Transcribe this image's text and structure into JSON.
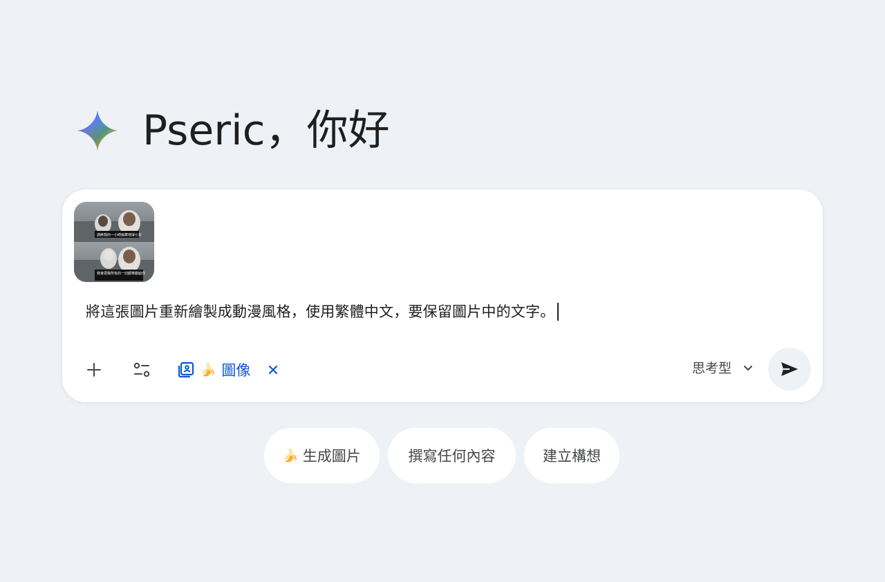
{
  "greeting": {
    "text": "Pseric，你好"
  },
  "composer": {
    "attachment": {
      "caption_top": "請將我的一小時換算地球七年",
      "caption_bottom": "我會把我所有的一切都奉獻給你"
    },
    "prompt": "將這張圖片重新繪製成動漫風格，使用繁體中文，要保留圖片中的文字。",
    "tool_chip": {
      "emoji": "🍌",
      "label": "圖像"
    },
    "mode": {
      "label": "思考型"
    }
  },
  "suggestions": [
    {
      "emoji": "🍌",
      "label": "生成圖片"
    },
    {
      "emoji": "",
      "label": "撰寫任何內容"
    },
    {
      "emoji": "",
      "label": "建立構想"
    }
  ],
  "icons": {
    "sparkle": "gemini-sparkle-icon",
    "plus": "plus-icon",
    "tools": "tools-icon",
    "image_tool": "image-tool-icon",
    "close": "close-icon",
    "chevron": "chevron-down-icon",
    "send": "send-icon"
  },
  "colors": {
    "background": "#eef2f7",
    "accent": "#0b57d0",
    "text": "#1f1f1f"
  }
}
